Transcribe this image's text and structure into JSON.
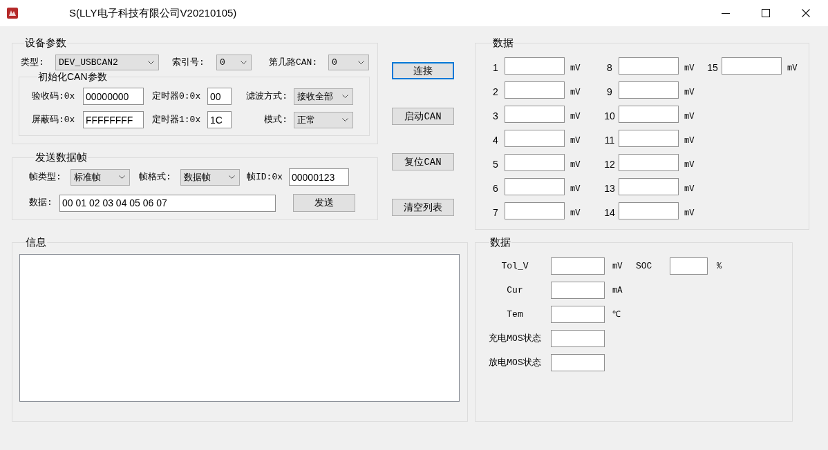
{
  "window": {
    "title": "S(LLY电子科技有限公司V20210105)"
  },
  "device_params": {
    "title": "设备参数",
    "fields": [
      {
        "label": "类型:",
        "kind": "dropdown",
        "value": "DEV_USBCAN2"
      },
      {
        "label": "索引号:",
        "kind": "dropdown",
        "value": "0"
      },
      {
        "label": "第几路CAN:",
        "kind": "dropdown",
        "value": "0"
      }
    ],
    "init_can": {
      "title": "初始化CAN参数",
      "rows": [
        [
          {
            "label": "验收码:0x",
            "kind": "input",
            "value": "00000000"
          },
          {
            "label": "定时器0:0x",
            "kind": "input",
            "value": "00"
          },
          {
            "label": "滤波方式:",
            "kind": "dropdown",
            "value": "接收全部"
          }
        ],
        [
          {
            "label": "屏蔽码:0x",
            "kind": "input",
            "value": "FFFFFFFF"
          },
          {
            "label": "定时器1:0x",
            "kind": "input",
            "value": "1C"
          },
          {
            "label": "模式:",
            "kind": "dropdown",
            "value": "正常"
          }
        ]
      ]
    }
  },
  "send_frame": {
    "title": "发送数据帧",
    "frame_fields": [
      {
        "label": "帧类型:",
        "kind": "dropdown",
        "value": "标准帧"
      },
      {
        "label": "帧格式:",
        "kind": "dropdown",
        "value": "数据帧"
      },
      {
        "label": "帧ID:0x",
        "kind": "input",
        "value": "00000123"
      }
    ],
    "data_field": {
      "label": "数据:",
      "kind": "input",
      "value": "00 01 02 03 04 05 06 07"
    },
    "send_button": {
      "label": "发送"
    }
  },
  "actions": [
    {
      "label": "连接",
      "focused": true
    },
    {
      "label": "启动CAN",
      "focused": false
    },
    {
      "label": "复位CAN",
      "focused": false
    },
    {
      "label": "清空列表",
      "focused": false
    }
  ],
  "info": {
    "title": "信息"
  },
  "voltage_data": {
    "title": "数据",
    "cells": [
      {
        "label": "1",
        "unit": "mV"
      },
      {
        "label": "2",
        "unit": "mV"
      },
      {
        "label": "3",
        "unit": "mV"
      },
      {
        "label": "4",
        "unit": "mV"
      },
      {
        "label": "5",
        "unit": "mV"
      },
      {
        "label": "6",
        "unit": "mV"
      },
      {
        "label": "7",
        "unit": "mV"
      },
      {
        "label": "8",
        "unit": "mV"
      },
      {
        "label": "9",
        "unit": "mV"
      },
      {
        "label": "10",
        "unit": "mV"
      },
      {
        "label": "11",
        "unit": "mV"
      },
      {
        "label": "12",
        "unit": "mV"
      },
      {
        "label": "13",
        "unit": "mV"
      },
      {
        "label": "14",
        "unit": "mV"
      },
      {
        "label": "15",
        "unit": "mV"
      }
    ]
  },
  "status_data": {
    "title": "数据",
    "rows": [
      [
        {
          "label": "Tol_V",
          "unit": "mV"
        },
        {
          "label": "SOC",
          "unit": "%"
        }
      ],
      [
        {
          "label": "Cur",
          "unit": "mA"
        }
      ],
      [
        {
          "label": "Tem",
          "unit": "℃"
        }
      ],
      [
        {
          "label": "充电MOS状态"
        }
      ],
      [
        {
          "label": "放电MOS状态"
        }
      ]
    ]
  }
}
